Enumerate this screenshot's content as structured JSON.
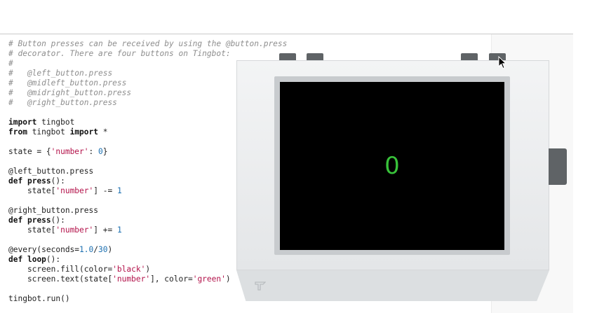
{
  "code_lines": [
    [
      {
        "t": "# Button presses can be received by using the @button.press",
        "c": "c"
      }
    ],
    [
      {
        "t": "# decorator. There are four buttons on Tingbot:",
        "c": "c"
      }
    ],
    [
      {
        "t": "#",
        "c": "c"
      }
    ],
    [
      {
        "t": "#   @left_button.press",
        "c": "c"
      }
    ],
    [
      {
        "t": "#   @midleft_button.press",
        "c": "c"
      }
    ],
    [
      {
        "t": "#   @midright_button.press",
        "c": "c"
      }
    ],
    [
      {
        "t": "#   @right_button.press",
        "c": "c"
      }
    ],
    [],
    [
      {
        "t": "import",
        "c": "k"
      },
      {
        "t": " tingbot"
      }
    ],
    [
      {
        "t": "from",
        "c": "k"
      },
      {
        "t": " tingbot "
      },
      {
        "t": "import",
        "c": "k"
      },
      {
        "t": " *"
      }
    ],
    [],
    [
      {
        "t": "state = {"
      },
      {
        "t": "'number'",
        "c": "s"
      },
      {
        "t": ": "
      },
      {
        "t": "0",
        "c": "n"
      },
      {
        "t": "}"
      }
    ],
    [],
    [
      {
        "t": "@left_button.press"
      }
    ],
    [
      {
        "t": "def",
        "c": "k"
      },
      {
        "t": " "
      },
      {
        "t": "press",
        "c": "f"
      },
      {
        "t": "():"
      }
    ],
    [
      {
        "t": "    state["
      },
      {
        "t": "'number'",
        "c": "s"
      },
      {
        "t": "] -= "
      },
      {
        "t": "1",
        "c": "n"
      }
    ],
    [],
    [
      {
        "t": "@right_button.press"
      }
    ],
    [
      {
        "t": "def",
        "c": "k"
      },
      {
        "t": " "
      },
      {
        "t": "press",
        "c": "f"
      },
      {
        "t": "():"
      }
    ],
    [
      {
        "t": "    state["
      },
      {
        "t": "'number'",
        "c": "s"
      },
      {
        "t": "] += "
      },
      {
        "t": "1",
        "c": "n"
      }
    ],
    [],
    [
      {
        "t": "@every(seconds="
      },
      {
        "t": "1.0",
        "c": "n"
      },
      {
        "t": "/"
      },
      {
        "t": "30",
        "c": "n"
      },
      {
        "t": ")"
      }
    ],
    [
      {
        "t": "def",
        "c": "k"
      },
      {
        "t": " "
      },
      {
        "t": "loop",
        "c": "f"
      },
      {
        "t": "():"
      }
    ],
    [
      {
        "t": "    screen.fill(color="
      },
      {
        "t": "'black'",
        "c": "s"
      },
      {
        "t": ")"
      }
    ],
    [
      {
        "t": "    screen.text(state["
      },
      {
        "t": "'number'",
        "c": "s"
      },
      {
        "t": "], color="
      },
      {
        "t": "'green'",
        "c": "s"
      },
      {
        "t": ")"
      }
    ],
    [],
    [
      {
        "t": "tingbot.run()"
      }
    ]
  ],
  "simulator": {
    "screen_text": "0",
    "screen_color": "#38c23a",
    "screen_background": "#000000",
    "buttons": [
      "left-button",
      "midleft-button",
      "midright-button",
      "right-button"
    ]
  }
}
